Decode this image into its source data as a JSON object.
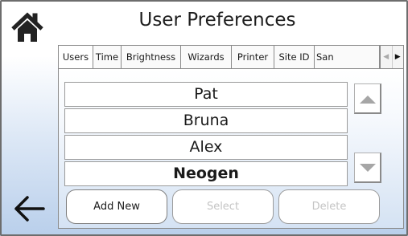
{
  "header": {
    "title": "User Preferences",
    "home_icon": "home-icon"
  },
  "tabs": [
    {
      "label": "Users",
      "active": true
    },
    {
      "label": "Time"
    },
    {
      "label": "Brightness"
    },
    {
      "label": "Wizards"
    },
    {
      "label": "Printer"
    },
    {
      "label": "Site ID"
    },
    {
      "label": "San"
    }
  ],
  "tab_scroll": {
    "left_icon": "triangle-left-icon",
    "right_icon": "triangle-right-icon"
  },
  "users": [
    {
      "name": "Pat"
    },
    {
      "name": "Bruna"
    },
    {
      "name": "Alex"
    },
    {
      "name": "Neogen",
      "selected": true
    }
  ],
  "list_scroll": {
    "up_icon": "triangle-up-icon",
    "down_icon": "triangle-down-icon"
  },
  "actions": {
    "add_new": "Add New",
    "select": "Select",
    "delete": "Delete"
  },
  "footer": {
    "back_icon": "arrow-left-icon"
  },
  "colors": {
    "border": "#8b8b8b",
    "disabled_text": "#c4c4c4",
    "gradient_bottom": "#b9cfeb"
  }
}
